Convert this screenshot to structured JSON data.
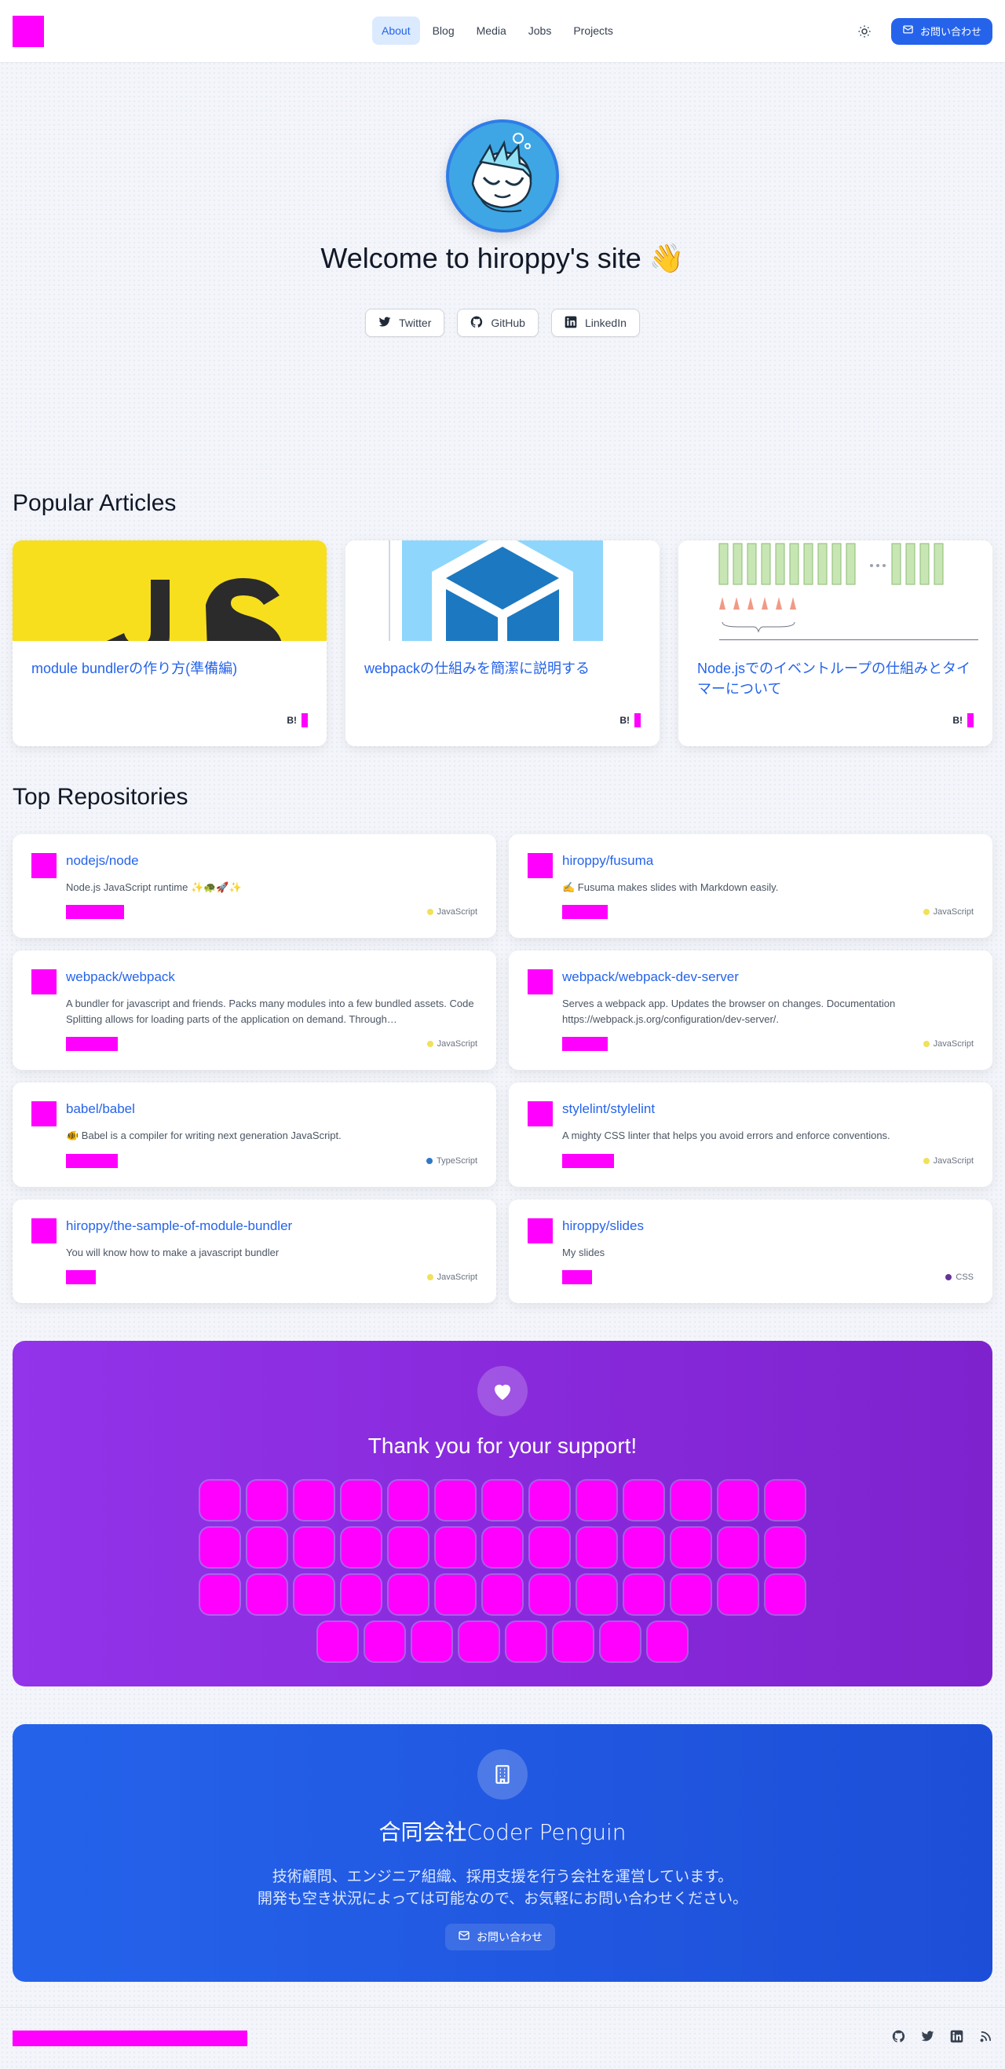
{
  "nav": {
    "items": [
      {
        "label": "About",
        "active": true
      },
      {
        "label": "Blog",
        "active": false
      },
      {
        "label": "Media",
        "active": false
      },
      {
        "label": "Jobs",
        "active": false
      },
      {
        "label": "Projects",
        "active": false
      }
    ],
    "contact_label": "お問い合わせ",
    "theme_icon": "sun-icon"
  },
  "hero": {
    "title": "Welcome to hiroppy's site 👋",
    "social": [
      {
        "label": "Twitter",
        "icon": "twitter-icon"
      },
      {
        "label": "GitHub",
        "icon": "github-icon"
      },
      {
        "label": "LinkedIn",
        "icon": "linkedin-icon"
      }
    ]
  },
  "popular": {
    "title": "Popular Articles",
    "articles": [
      {
        "title": "module bundlerの作り方(準備編)",
        "badge": "B!"
      },
      {
        "title": "webpackの仕組みを簡潔に説明する",
        "badge": "B!"
      },
      {
        "title": "Node.jsでのイベントループの仕組みとタイマーについて",
        "badge": "B!"
      }
    ]
  },
  "repos": {
    "title": "Top Repositories",
    "items": [
      {
        "name": "nodejs/node",
        "desc": "Node.js JavaScript runtime ✨🐢🚀✨",
        "lang": "JavaScript",
        "color": "#f1e05a"
      },
      {
        "name": "hiroppy/fusuma",
        "desc": "✍️ Fusuma makes slides with Markdown easily.",
        "lang": "JavaScript",
        "color": "#f1e05a"
      },
      {
        "name": "webpack/webpack",
        "desc": "A bundler for javascript and friends. Packs many modules into a few bundled assets. Code Splitting allows for loading parts of the application on demand. Through…",
        "lang": "JavaScript",
        "color": "#f1e05a"
      },
      {
        "name": "webpack/webpack-dev-server",
        "desc": "Serves a webpack app. Updates the browser on changes. Documentation https://webpack.js.org/configuration/dev-server/.",
        "lang": "JavaScript",
        "color": "#f1e05a"
      },
      {
        "name": "babel/babel",
        "desc": "🐠 Babel is a compiler for writing next generation JavaScript.",
        "lang": "TypeScript",
        "color": "#3178c6"
      },
      {
        "name": "stylelint/stylelint",
        "desc": "A mighty CSS linter that helps you avoid errors and enforce conventions.",
        "lang": "JavaScript",
        "color": "#f1e05a"
      },
      {
        "name": "hiroppy/the-sample-of-module-bundler",
        "desc": "You will know how to make a javascript bundler",
        "lang": "JavaScript",
        "color": "#f1e05a"
      },
      {
        "name": "hiroppy/slides",
        "desc": "My slides",
        "lang": "CSS",
        "color": "#663399"
      }
    ]
  },
  "sponsors": {
    "title": "Thank you for your support!",
    "rows": [
      13,
      13,
      13,
      8
    ]
  },
  "company": {
    "title": "合同会社Coder Penguin",
    "desc_line1": "技術顧問、エンジニア組織、採用支援を行う会社を運営しています。",
    "desc_line2": "開発も空き状況によっては可能なので、お気軽にお問い合わせください。",
    "button_label": "お問い合わせ"
  },
  "footer": {
    "icons": [
      "github-icon",
      "twitter-icon",
      "linkedin-icon",
      "rss-icon"
    ]
  }
}
